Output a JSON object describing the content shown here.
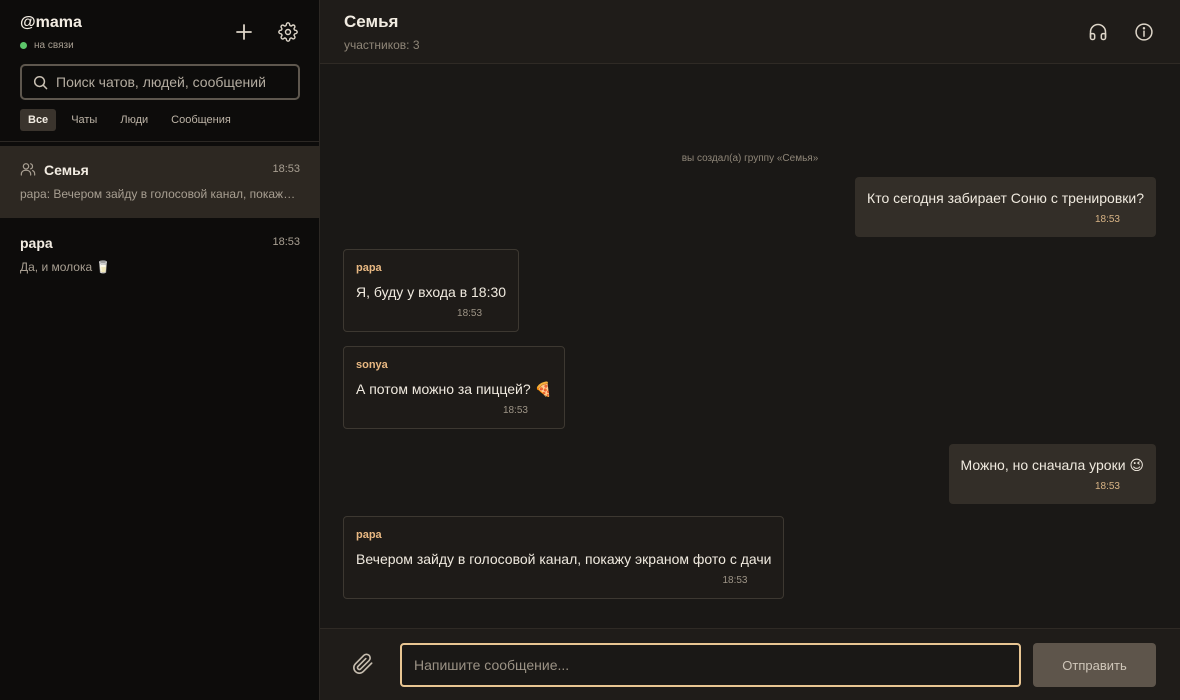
{
  "user": {
    "handle": "@mama",
    "status": "на связи"
  },
  "search": {
    "placeholder": "Поиск чатов, людей, сообщений"
  },
  "filters": [
    "Все",
    "Чаты",
    "Люди",
    "Сообщения"
  ],
  "chats": [
    {
      "name": "Семья",
      "time": "18:53",
      "preview": "papa: Вечером зайду в голосовой канал, покажу экраном фото с дачи",
      "is_group": true,
      "selected": true
    },
    {
      "name": "papa",
      "time": "18:53",
      "preview": "Да, и молока 🥛",
      "is_group": false,
      "selected": false
    }
  ],
  "header": {
    "title": "Семья",
    "subtitle": "участников: 3"
  },
  "system_note": "вы создал(а) группу «Семья»",
  "messages": [
    {
      "direction": "out",
      "author": "",
      "text": "Кто сегодня забирает Соню с тренировки?",
      "time": "18:53"
    },
    {
      "direction": "in",
      "author": "papa",
      "text": "Я, буду у входа в 18:30",
      "time": "18:53"
    },
    {
      "direction": "in",
      "author": "sonya",
      "text": "А потом можно за пиццей? 🍕",
      "time": "18:53"
    },
    {
      "direction": "out",
      "author": "",
      "text": "Можно, но сначала уроки 😉",
      "time": "18:53"
    },
    {
      "direction": "in",
      "author": "papa",
      "text": "Вечером зайду в голосовой канал, покажу экраном фото с дачи",
      "time": "18:53"
    }
  ],
  "composer": {
    "placeholder": "Напишите сообщение...",
    "send_label": "Отправить"
  },
  "colors": {
    "accent": "#e8b882",
    "online": "#5cc66a",
    "input_border": "#e8c592"
  },
  "icons": {
    "add": "plus-icon",
    "settings": "gear-icon",
    "search": "search-icon",
    "group": "users-icon",
    "voice": "headphones-icon",
    "info": "info-icon",
    "attach": "paperclip-icon"
  }
}
